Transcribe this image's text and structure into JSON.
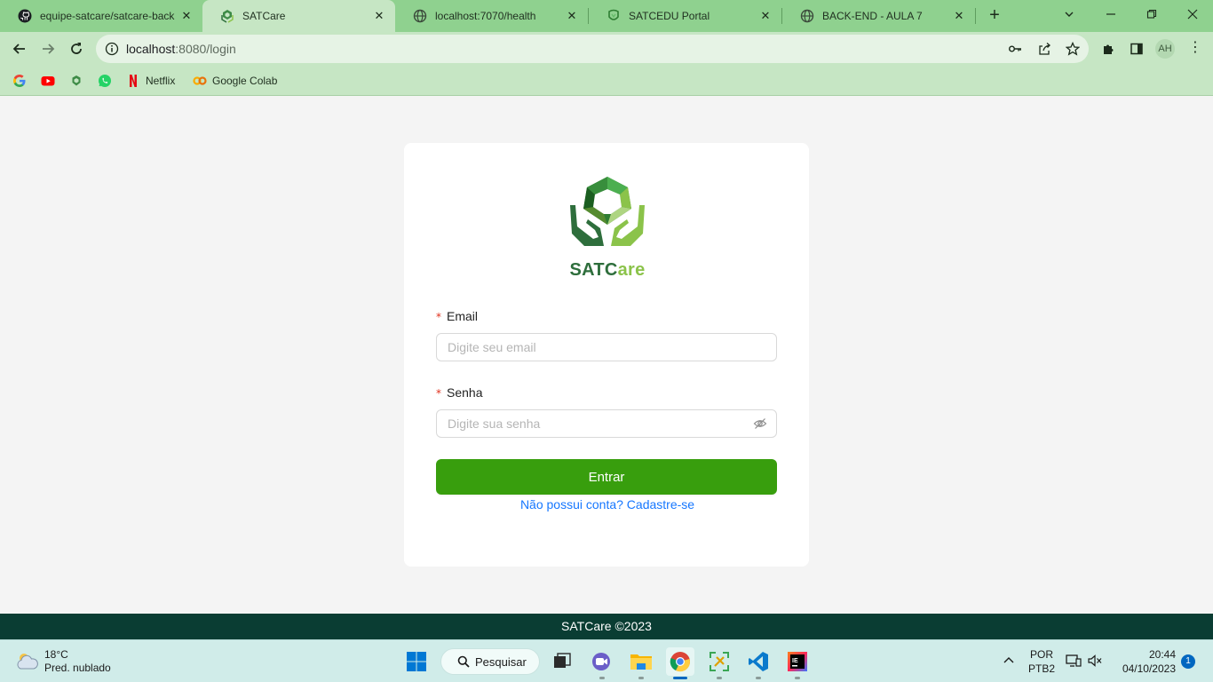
{
  "browser": {
    "tabs": [
      {
        "title": "equipe-satcare/satcare-back",
        "favicon": "github-icon"
      },
      {
        "title": "SATCare",
        "favicon": "satcare-icon",
        "active": true
      },
      {
        "title": "localhost:7070/health",
        "favicon": "globe-icon"
      },
      {
        "title": "SATCEDU Portal",
        "favicon": "satcedu-icon"
      },
      {
        "title": "BACK-END - AULA 7",
        "favicon": "globe-icon"
      }
    ],
    "address": {
      "host": "localhost",
      "path": ":8080/login"
    },
    "profile_initials": "AH",
    "bookmarks": [
      {
        "label": "",
        "icon": "google-icon"
      },
      {
        "label": "",
        "icon": "youtube-icon"
      },
      {
        "label": "",
        "icon": "satcare-icon"
      },
      {
        "label": "",
        "icon": "whatsapp-icon"
      },
      {
        "label": "Netflix",
        "icon": "netflix-icon"
      },
      {
        "label": "Google Colab",
        "icon": "colab-icon"
      }
    ],
    "theme_color": "#8fd18f"
  },
  "login": {
    "brand_part1": "SATC",
    "brand_part2": "are",
    "required_mark": "*",
    "email_label": "Email",
    "email_placeholder": "Digite seu email",
    "password_label": "Senha",
    "password_placeholder": "Digite sua senha",
    "submit_label": "Entrar",
    "signup_link": "Não possui conta? Cadastre-se",
    "button_color": "#389e0d",
    "link_color": "#1677ff"
  },
  "footer": {
    "text": "SATCare ©2023",
    "color": "#0a3d33"
  },
  "taskbar": {
    "weather_temp": "18°C",
    "weather_desc": "Pred. nublado",
    "search_label": "Pesquisar",
    "lang_top": "POR",
    "lang_bottom": "PTB2",
    "time": "20:44",
    "date": "04/10/2023",
    "notification_count": "1"
  }
}
